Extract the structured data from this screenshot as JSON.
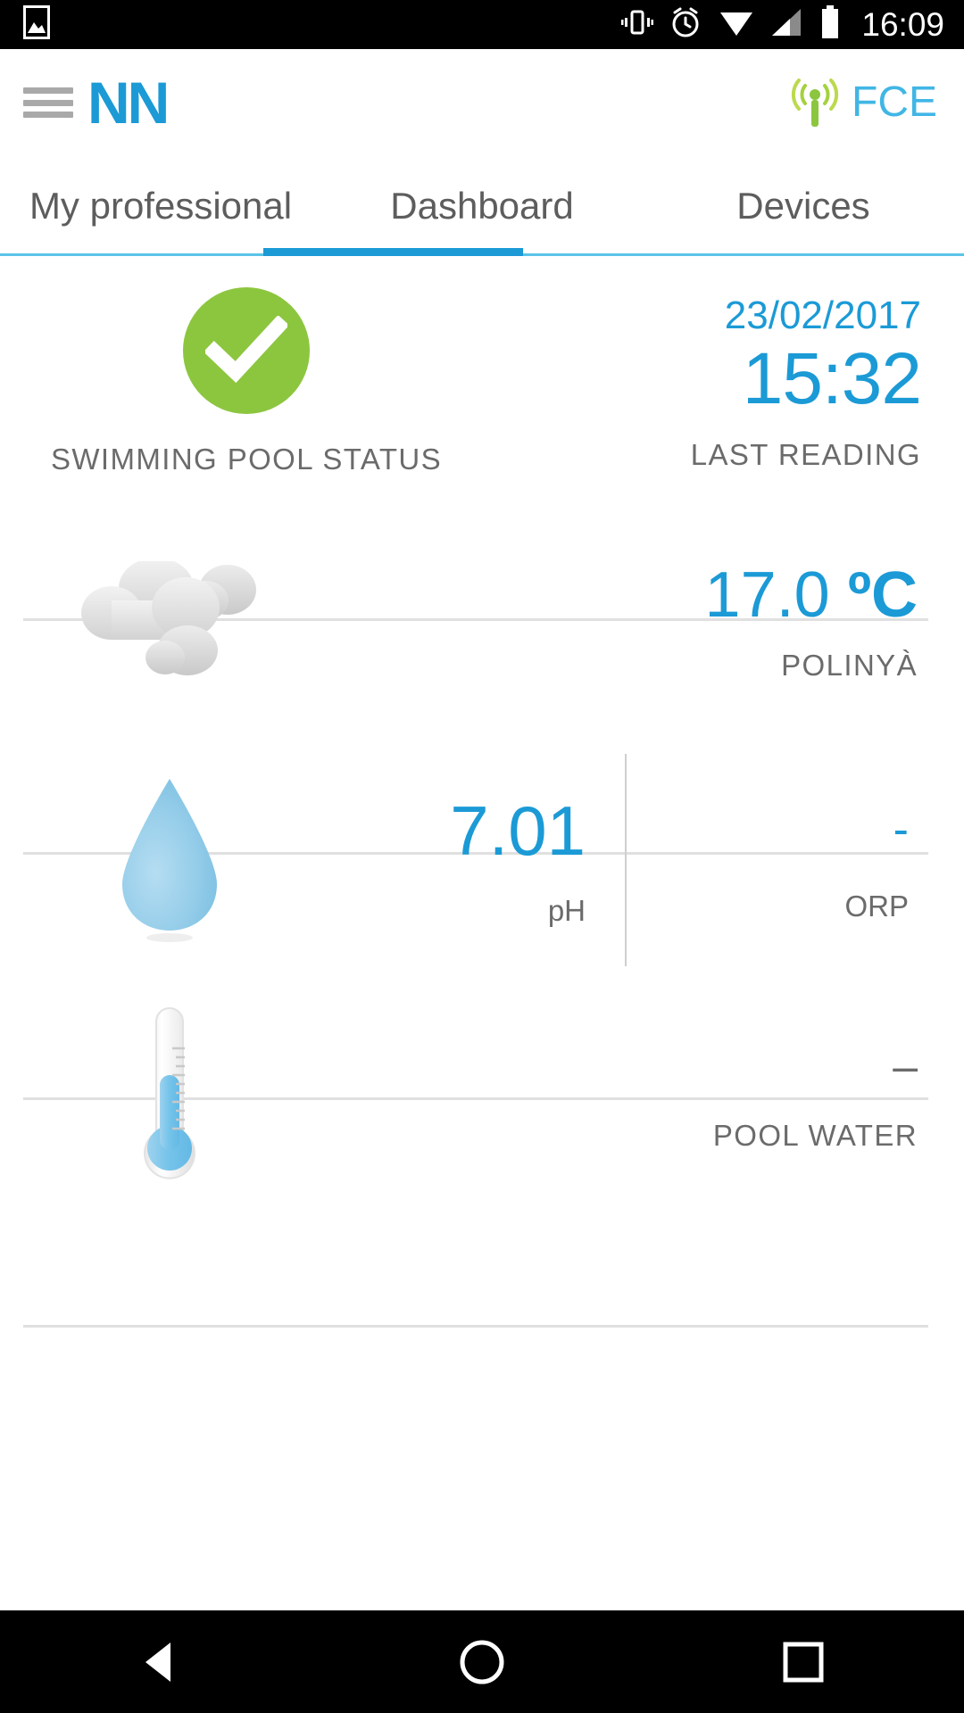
{
  "statusbar": {
    "time": "16:09",
    "icons": {
      "gallery": "image-icon",
      "vibrate": "vibrate-icon",
      "alarm": "alarm-clock-icon",
      "wifi": "wifi-icon",
      "signal": "cell-signal-icon",
      "battery": "battery-icon"
    }
  },
  "appbar": {
    "menu_icon": "hamburger-menu-icon",
    "brand": "NN",
    "connection_icon": "antenna-signal-icon",
    "connection_label": "FCE",
    "brand_color": "#1b9ad6",
    "antenna_color": "#8cc63f"
  },
  "tabs": {
    "items": [
      {
        "label": "My professional",
        "active": false
      },
      {
        "label": "Dashboard",
        "active": true
      },
      {
        "label": "Devices",
        "active": false
      }
    ],
    "indicator_color": "#1b9ad6",
    "rule_color": "#5bc4e8"
  },
  "dashboard": {
    "status": {
      "icon": "green-check-circle-icon",
      "icon_color": "#8cc63f",
      "caption": "SWIMMING POOL STATUS",
      "date": "23/02/2017",
      "time": "15:32",
      "reading_caption": "LAST READING"
    },
    "weather": {
      "icon": "cloudy-weather-icon",
      "temperature": "17.0",
      "unit": "ºC",
      "location": "POLINYÀ"
    },
    "water_quality": {
      "icon": "water-drop-icon",
      "ph_value": "7.01",
      "ph_label": "pH",
      "orp_value": "-",
      "orp_label": "ORP"
    },
    "pool_water": {
      "icon": "thermometer-icon",
      "value": "–",
      "label": "POOL WATER"
    }
  },
  "navbar": {
    "back": "back-triangle-icon",
    "home": "home-circle-icon",
    "recents": "recents-square-icon"
  }
}
